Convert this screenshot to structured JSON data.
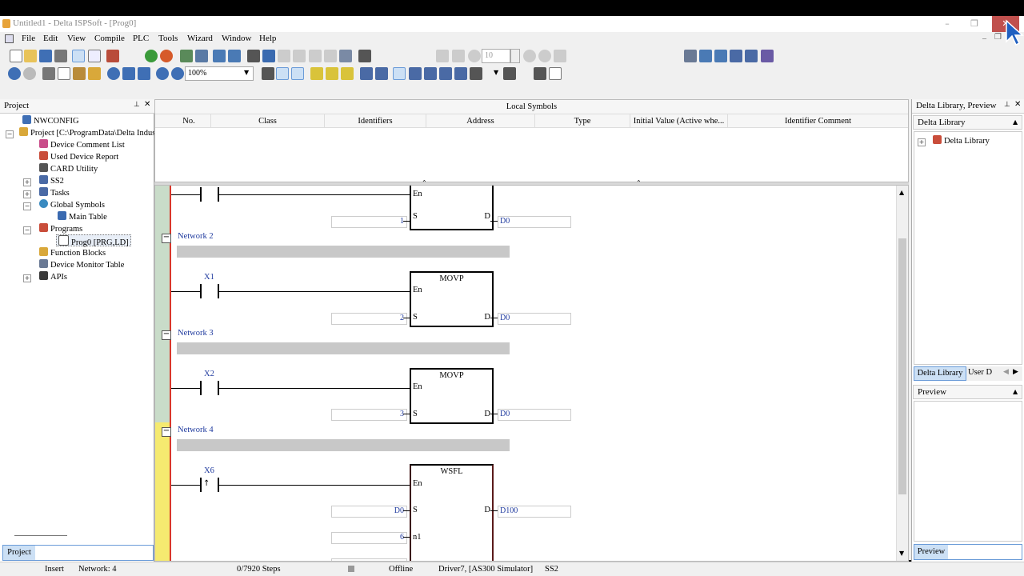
{
  "window": {
    "title": "Untitled1 - Delta ISPSoft - [Prog0]"
  },
  "menu": [
    "File",
    "Edit",
    "View",
    "Compile",
    "PLC",
    "Tools",
    "Wizard",
    "Window",
    "Help"
  ],
  "toolbar": {
    "zoom": "100%",
    "step_value": "10"
  },
  "project_panel": {
    "title": "Project",
    "tab_label": "Project",
    "tree": [
      {
        "label": "NWCONFIG",
        "icon": "network-config-icon"
      },
      {
        "label": "Project [C:\\ProgramData\\Delta Indus",
        "icon": "project-icon"
      },
      {
        "label": "Device Comment List",
        "icon": "comment-list-icon"
      },
      {
        "label": "Used Device Report",
        "icon": "device-report-icon"
      },
      {
        "label": "CARD Utility",
        "icon": "card-utility-icon"
      },
      {
        "label": "SS2",
        "icon": "ss2-icon"
      },
      {
        "label": "Tasks",
        "icon": "tasks-icon"
      },
      {
        "label": "Global Symbols",
        "icon": "global-symbols-icon"
      },
      {
        "label": "Main Table",
        "icon": "table-icon"
      },
      {
        "label": "Programs",
        "icon": "programs-icon"
      },
      {
        "label": "Prog0 [PRG,LD]",
        "icon": "program-icon"
      },
      {
        "label": "Function Blocks",
        "icon": "function-blocks-icon"
      },
      {
        "label": "Device Monitor Table",
        "icon": "monitor-table-icon"
      },
      {
        "label": "APIs",
        "icon": "apis-icon"
      }
    ]
  },
  "local_symbols": {
    "title": "Local Symbols",
    "columns": [
      "No.",
      "Class",
      "Identifiers",
      "Address",
      "Type",
      "Initial Value (Active whe...",
      "Identifier Comment"
    ]
  },
  "ladder": {
    "top_block": {
      "s_value": "1",
      "d_value": "D0"
    },
    "networks": [
      {
        "label": "Network 2",
        "contact": "X1",
        "function": "MOVP",
        "s_value": "2",
        "d_value": "D0"
      },
      {
        "label": "Network 3",
        "contact": "X2",
        "function": "MOVP",
        "s_value": "3",
        "d_value": "D0"
      },
      {
        "label": "Network 4",
        "contact": "X6",
        "function": "WSFL",
        "s_value": "D0",
        "d_value": "D100",
        "n1_value": "6"
      }
    ],
    "pins": {
      "en": "En",
      "s": "S",
      "d": "D",
      "n1": "n1"
    }
  },
  "library": {
    "title": "Delta Library, Preview",
    "subtitle": "Delta Library",
    "tree_item": "Delta Library",
    "tabs": [
      "Delta Library",
      "User D"
    ],
    "preview_title": "Preview",
    "preview_tab": "Preview"
  },
  "status": {
    "mode": "Insert",
    "network": "Network: 4",
    "steps": "0/7920 Steps",
    "connection": "Offline",
    "driver": "Driver7, [AS300 Simulator]",
    "device": "SS2"
  },
  "colors": {
    "rail": "#d9372b",
    "label_blue": "#1f3a9e",
    "selected_tab": "#cce0f5"
  }
}
